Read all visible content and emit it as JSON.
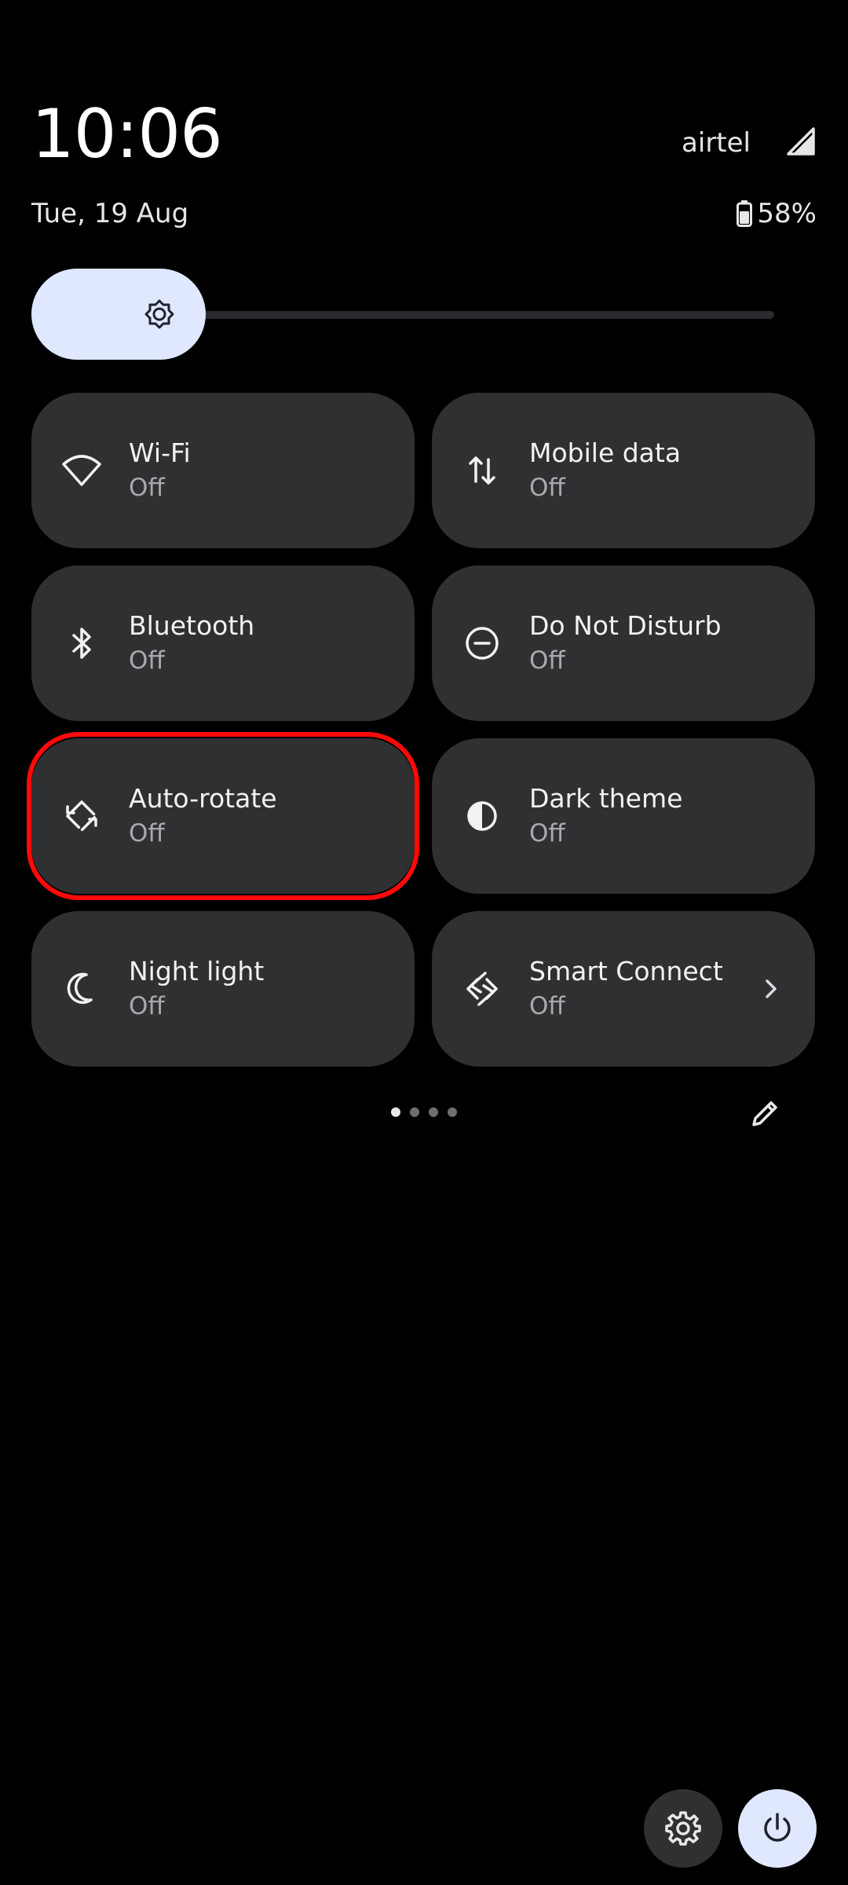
{
  "status": {
    "time": "10:06",
    "date": "Tue, 19 Aug",
    "carrier": "airtel",
    "battery": "58%"
  },
  "brightness": {
    "level_fraction": 0.2
  },
  "tiles": [
    {
      "label": "Wi-Fi",
      "state": "Off",
      "icon": "wifi-icon"
    },
    {
      "label": "Mobile data",
      "state": "Off",
      "icon": "mobile-data-icon"
    },
    {
      "label": "Bluetooth",
      "state": "Off",
      "icon": "bluetooth-icon"
    },
    {
      "label": "Do Not Disturb",
      "state": "Off",
      "icon": "do-not-disturb-icon"
    },
    {
      "label": "Auto-rotate",
      "state": "Off",
      "icon": "auto-rotate-icon"
    },
    {
      "label": "Dark theme",
      "state": "Off",
      "icon": "dark-theme-icon"
    },
    {
      "label": "Night light",
      "state": "Off",
      "icon": "night-light-icon"
    },
    {
      "label": "Smart Connect",
      "state": "Off",
      "icon": "smart-connect-icon"
    }
  ],
  "pagination": {
    "pages": 4,
    "current": 1
  },
  "colors": {
    "tile_bg": "#2f3032",
    "accent": "#dfe8ff",
    "highlight": "#ff0a0a"
  }
}
